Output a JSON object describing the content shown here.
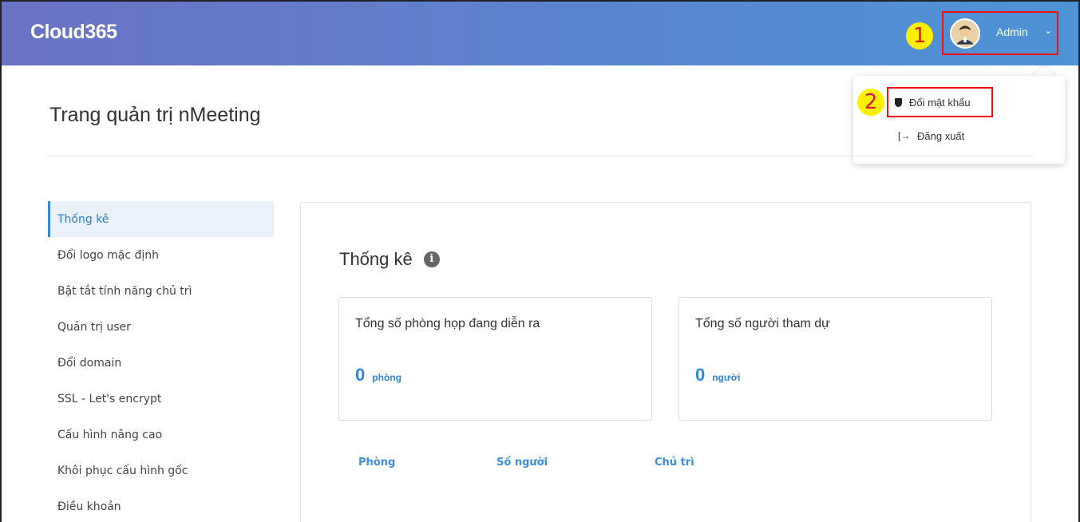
{
  "header": {
    "brand": "Cloud365",
    "user": {
      "name": "Admin",
      "menu_icon": "chevron-down-icon"
    }
  },
  "annotations": {
    "step1": "1",
    "step2": "2"
  },
  "dropdown": {
    "items": [
      {
        "label": "Đổi mật khẩu",
        "icon": "shield-icon"
      },
      {
        "label": "Đăng xuất",
        "icon": "logout-icon"
      }
    ]
  },
  "page": {
    "title": "Trang quản trị nMeeting"
  },
  "sidebar": {
    "items": [
      {
        "label": "Thống kê",
        "active": true
      },
      {
        "label": "Đổi logo mặc định"
      },
      {
        "label": "Bật tắt tính năng chủ trì"
      },
      {
        "label": "Quản trị user"
      },
      {
        "label": "Đổi domain"
      },
      {
        "label": "SSL - Let's encrypt"
      },
      {
        "label": "Cấu hình nâng cao"
      },
      {
        "label": "Khôi phục cấu hình gốc"
      },
      {
        "label": "Điều khoản"
      }
    ]
  },
  "main": {
    "title": "Thống kê",
    "cards": [
      {
        "label": "Tổng số phòng họp đang diễn ra",
        "value": "0",
        "unit": "phòng"
      },
      {
        "label": "Tổng số người tham dự",
        "value": "0",
        "unit": "người"
      }
    ],
    "table": {
      "columns": [
        "Phòng",
        "Số người",
        "Chủ trì"
      ]
    }
  },
  "colors": {
    "accent": "#2f86e0",
    "header_start": "#6a72c4",
    "header_end": "#4d93d6",
    "highlight": "#ee1111",
    "badge": "#ffee00"
  }
}
